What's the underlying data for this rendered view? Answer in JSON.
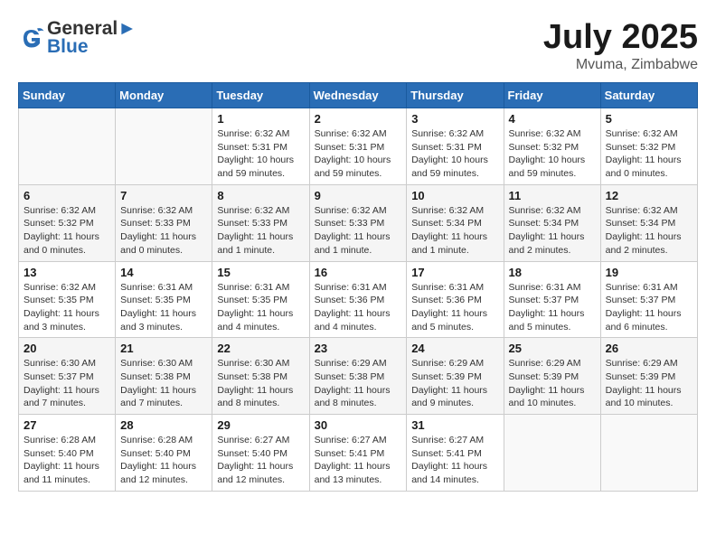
{
  "header": {
    "logo_line1": "General",
    "logo_line2": "Blue",
    "month": "July 2025",
    "location": "Mvuma, Zimbabwe"
  },
  "weekdays": [
    "Sunday",
    "Monday",
    "Tuesday",
    "Wednesday",
    "Thursday",
    "Friday",
    "Saturday"
  ],
  "weeks": [
    [
      {
        "day": "",
        "info": ""
      },
      {
        "day": "",
        "info": ""
      },
      {
        "day": "1",
        "info": "Sunrise: 6:32 AM\nSunset: 5:31 PM\nDaylight: 10 hours and 59 minutes."
      },
      {
        "day": "2",
        "info": "Sunrise: 6:32 AM\nSunset: 5:31 PM\nDaylight: 10 hours and 59 minutes."
      },
      {
        "day": "3",
        "info": "Sunrise: 6:32 AM\nSunset: 5:31 PM\nDaylight: 10 hours and 59 minutes."
      },
      {
        "day": "4",
        "info": "Sunrise: 6:32 AM\nSunset: 5:32 PM\nDaylight: 10 hours and 59 minutes."
      },
      {
        "day": "5",
        "info": "Sunrise: 6:32 AM\nSunset: 5:32 PM\nDaylight: 11 hours and 0 minutes."
      }
    ],
    [
      {
        "day": "6",
        "info": "Sunrise: 6:32 AM\nSunset: 5:32 PM\nDaylight: 11 hours and 0 minutes."
      },
      {
        "day": "7",
        "info": "Sunrise: 6:32 AM\nSunset: 5:33 PM\nDaylight: 11 hours and 0 minutes."
      },
      {
        "day": "8",
        "info": "Sunrise: 6:32 AM\nSunset: 5:33 PM\nDaylight: 11 hours and 1 minute."
      },
      {
        "day": "9",
        "info": "Sunrise: 6:32 AM\nSunset: 5:33 PM\nDaylight: 11 hours and 1 minute."
      },
      {
        "day": "10",
        "info": "Sunrise: 6:32 AM\nSunset: 5:34 PM\nDaylight: 11 hours and 1 minute."
      },
      {
        "day": "11",
        "info": "Sunrise: 6:32 AM\nSunset: 5:34 PM\nDaylight: 11 hours and 2 minutes."
      },
      {
        "day": "12",
        "info": "Sunrise: 6:32 AM\nSunset: 5:34 PM\nDaylight: 11 hours and 2 minutes."
      }
    ],
    [
      {
        "day": "13",
        "info": "Sunrise: 6:32 AM\nSunset: 5:35 PM\nDaylight: 11 hours and 3 minutes."
      },
      {
        "day": "14",
        "info": "Sunrise: 6:31 AM\nSunset: 5:35 PM\nDaylight: 11 hours and 3 minutes."
      },
      {
        "day": "15",
        "info": "Sunrise: 6:31 AM\nSunset: 5:35 PM\nDaylight: 11 hours and 4 minutes."
      },
      {
        "day": "16",
        "info": "Sunrise: 6:31 AM\nSunset: 5:36 PM\nDaylight: 11 hours and 4 minutes."
      },
      {
        "day": "17",
        "info": "Sunrise: 6:31 AM\nSunset: 5:36 PM\nDaylight: 11 hours and 5 minutes."
      },
      {
        "day": "18",
        "info": "Sunrise: 6:31 AM\nSunset: 5:37 PM\nDaylight: 11 hours and 5 minutes."
      },
      {
        "day": "19",
        "info": "Sunrise: 6:31 AM\nSunset: 5:37 PM\nDaylight: 11 hours and 6 minutes."
      }
    ],
    [
      {
        "day": "20",
        "info": "Sunrise: 6:30 AM\nSunset: 5:37 PM\nDaylight: 11 hours and 7 minutes."
      },
      {
        "day": "21",
        "info": "Sunrise: 6:30 AM\nSunset: 5:38 PM\nDaylight: 11 hours and 7 minutes."
      },
      {
        "day": "22",
        "info": "Sunrise: 6:30 AM\nSunset: 5:38 PM\nDaylight: 11 hours and 8 minutes."
      },
      {
        "day": "23",
        "info": "Sunrise: 6:29 AM\nSunset: 5:38 PM\nDaylight: 11 hours and 8 minutes."
      },
      {
        "day": "24",
        "info": "Sunrise: 6:29 AM\nSunset: 5:39 PM\nDaylight: 11 hours and 9 minutes."
      },
      {
        "day": "25",
        "info": "Sunrise: 6:29 AM\nSunset: 5:39 PM\nDaylight: 11 hours and 10 minutes."
      },
      {
        "day": "26",
        "info": "Sunrise: 6:29 AM\nSunset: 5:39 PM\nDaylight: 11 hours and 10 minutes."
      }
    ],
    [
      {
        "day": "27",
        "info": "Sunrise: 6:28 AM\nSunset: 5:40 PM\nDaylight: 11 hours and 11 minutes."
      },
      {
        "day": "28",
        "info": "Sunrise: 6:28 AM\nSunset: 5:40 PM\nDaylight: 11 hours and 12 minutes."
      },
      {
        "day": "29",
        "info": "Sunrise: 6:27 AM\nSunset: 5:40 PM\nDaylight: 11 hours and 12 minutes."
      },
      {
        "day": "30",
        "info": "Sunrise: 6:27 AM\nSunset: 5:41 PM\nDaylight: 11 hours and 13 minutes."
      },
      {
        "day": "31",
        "info": "Sunrise: 6:27 AM\nSunset: 5:41 PM\nDaylight: 11 hours and 14 minutes."
      },
      {
        "day": "",
        "info": ""
      },
      {
        "day": "",
        "info": ""
      }
    ]
  ]
}
